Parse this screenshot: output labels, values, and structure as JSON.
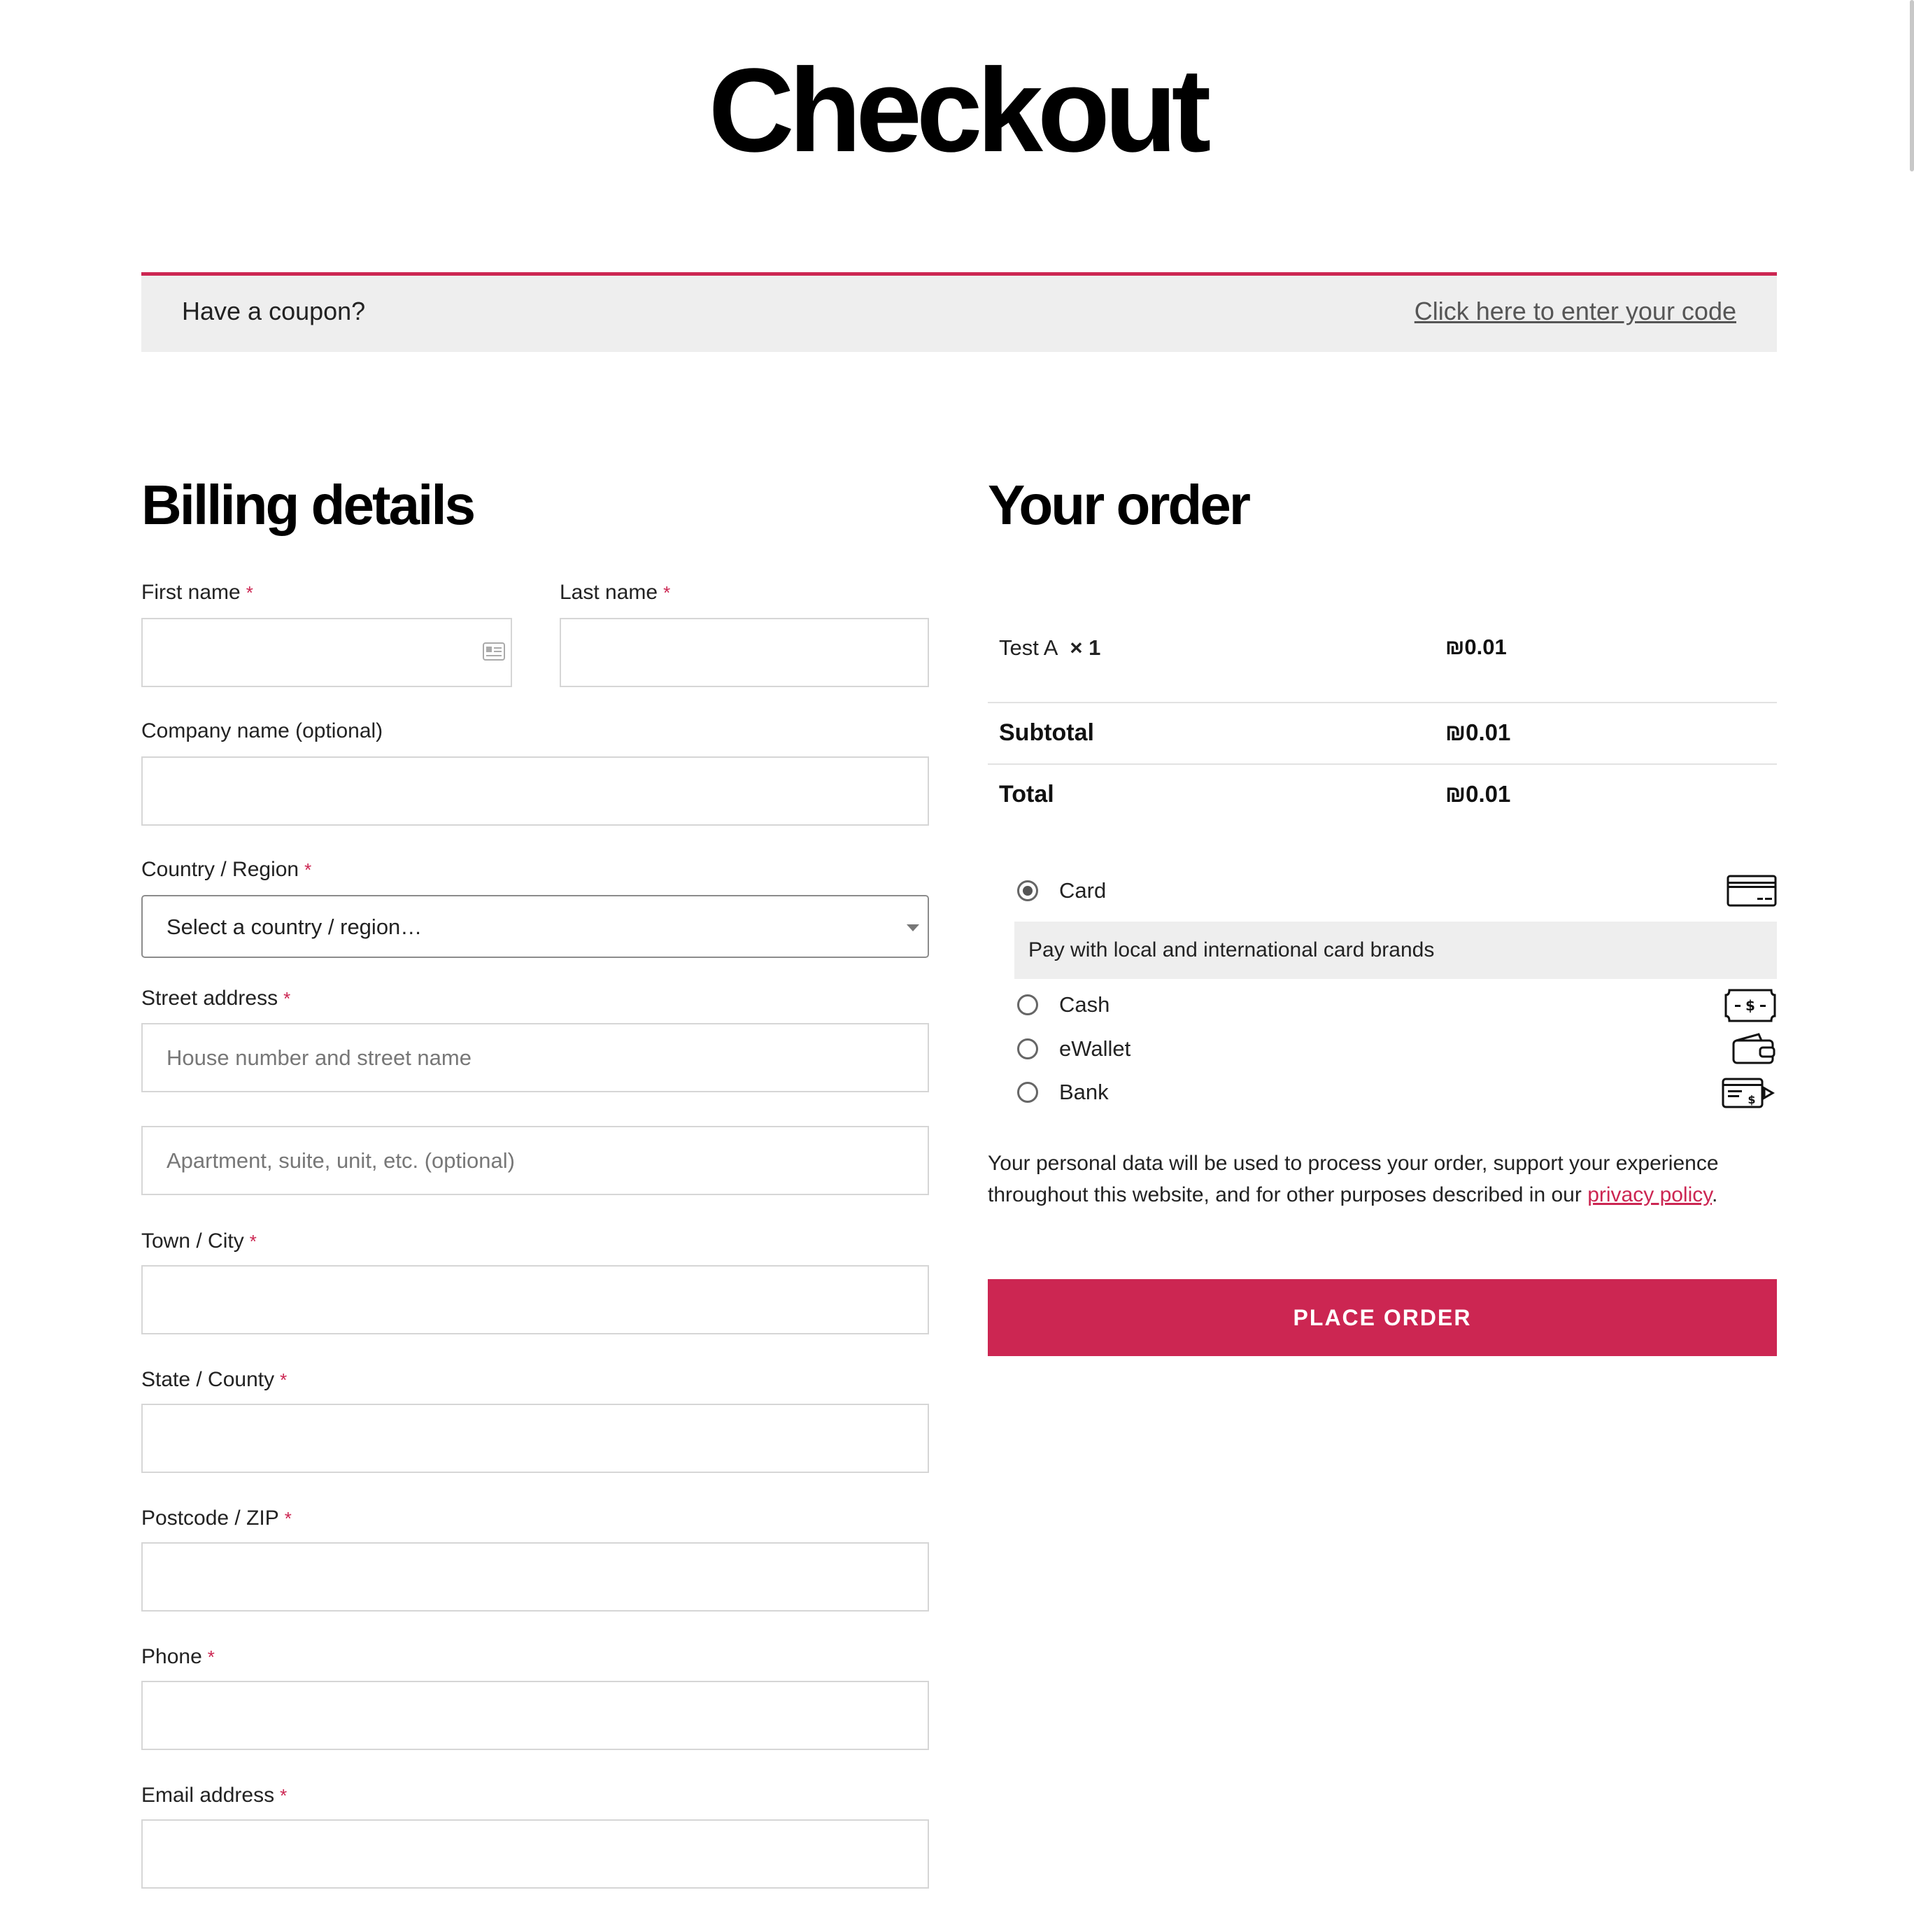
{
  "page_title": "Checkout",
  "coupon": {
    "question": "Have a coupon?",
    "link": "Click here to enter your code"
  },
  "billing": {
    "heading": "Billing details",
    "required_mark": "*",
    "first_name_label": "First name",
    "last_name_label": "Last name",
    "company_label": "Company name (optional)",
    "country_label": "Country / Region",
    "country_value": "Select a country / region…",
    "street_label": "Street address",
    "street_placeholder": "House number and street name",
    "street2_placeholder": "Apartment, suite, unit, etc. (optional)",
    "city_label": "Town / City",
    "state_label": "State / County",
    "postcode_label": "Postcode / ZIP",
    "phone_label": "Phone",
    "email_label": "Email address"
  },
  "order": {
    "heading": "Your order",
    "item_name": "Test A",
    "item_qty": "× 1",
    "item_price": "₪0.01",
    "subtotal_label": "Subtotal",
    "subtotal_value": "₪0.01",
    "total_label": "Total",
    "total_value": "₪0.01"
  },
  "payment": {
    "methods": [
      {
        "label": "Card",
        "selected": true,
        "icon": "credit-card-icon"
      },
      {
        "label": "Cash",
        "selected": false,
        "icon": "banknote-icon"
      },
      {
        "label": "eWallet",
        "selected": false,
        "icon": "wallet-icon"
      },
      {
        "label": "Bank",
        "selected": false,
        "icon": "bank-transfer-icon"
      }
    ],
    "card_description": "Pay with local and international card brands"
  },
  "privacy": {
    "text": "Your personal data will be used to process your order, support your experience throughout this website, and for other purposes described in our",
    "link": "privacy policy",
    "end": "."
  },
  "place_order_label": "PLACE ORDER",
  "colors": {
    "accent": "#cc2652",
    "panel": "#eeeeee",
    "border": "#d6d6d6"
  }
}
